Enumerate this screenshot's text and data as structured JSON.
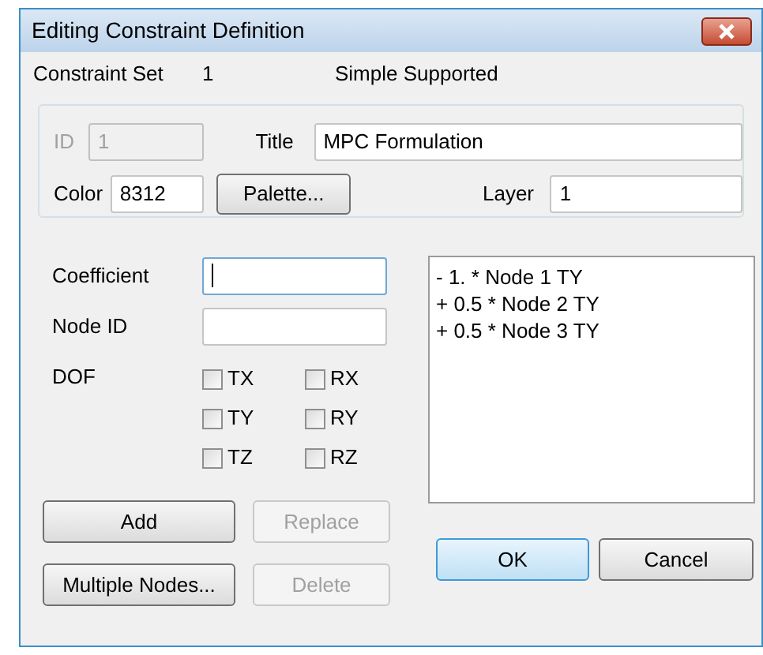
{
  "window": {
    "title": "Editing Constraint Definition"
  },
  "header": {
    "label": "Constraint Set",
    "set_number": "1",
    "set_name": "Simple Supported"
  },
  "id_field": {
    "label": "ID",
    "value": "1",
    "disabled": true
  },
  "title_field": {
    "label": "Title",
    "value": "MPC Formulation"
  },
  "color_field": {
    "label": "Color",
    "value": "8312"
  },
  "palette_button": {
    "label": "Palette..."
  },
  "layer_field": {
    "label": "Layer",
    "value": "1"
  },
  "coefficient_field": {
    "label": "Coefficient",
    "focused": true
  },
  "node_id_field": {
    "label": "Node ID",
    "focused": false
  },
  "dof": {
    "label": "DOF",
    "options": [
      {
        "label": "TX",
        "checked": false
      },
      {
        "label": "RX",
        "checked": false
      },
      {
        "label": "TY",
        "checked": false
      },
      {
        "label": "RY",
        "checked": false
      },
      {
        "label": "TZ",
        "checked": false
      },
      {
        "label": "RZ",
        "checked": false
      }
    ]
  },
  "terms": [
    "- 1. * Node 1 TY",
    "+ 0.5 * Node 2 TY",
    "+ 0.5 * Node 3 TY"
  ],
  "left_buttons": [
    {
      "label": "Add",
      "disabled": false
    },
    {
      "label": "Replace",
      "disabled": true
    },
    {
      "label": "Multiple Nodes...",
      "disabled": false
    },
    {
      "label": "Delete",
      "disabled": true
    }
  ],
  "dialog_buttons": [
    {
      "label": "OK",
      "default": true
    },
    {
      "label": "Cancel",
      "default": false
    }
  ]
}
